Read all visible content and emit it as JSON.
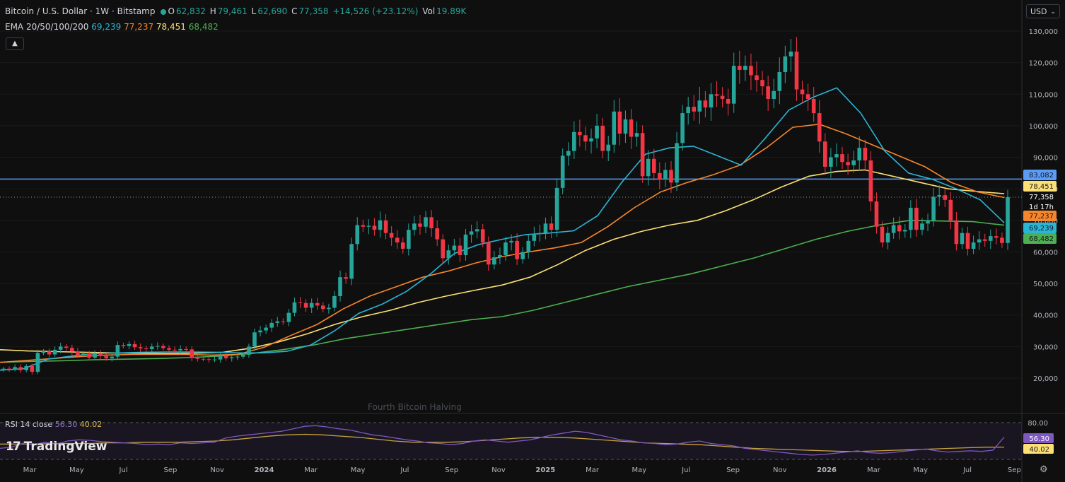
{
  "header": {
    "symbol": "Bitcoin / U.S. Dollar · 1W · Bitstamp",
    "open_label": "O",
    "open": "62,832",
    "high_label": "H",
    "high": "79,461",
    "low_label": "L",
    "low": "62,690",
    "close_label": "C",
    "close": "77,358",
    "change": "+14,526 (+23.12%)",
    "vol_label": "Vol",
    "vol": "19.89K"
  },
  "ema": {
    "label": "EMA 20/50/100/200",
    "v20": "69,239",
    "v50": "77,237",
    "v100": "78,451",
    "v200": "68,482"
  },
  "rsi": {
    "label": "RSI 14 close",
    "value": "56.30",
    "ma": "40.02"
  },
  "currency": {
    "label": "USD"
  },
  "logo": {
    "mark": "17",
    "text": "TradingView"
  },
  "colors": {
    "up": "#26a69a",
    "down": "#f23645",
    "ema20": "#2ab5d5",
    "ema50": "#f7862a",
    "ema100": "#fde073",
    "ema200": "#4caf50",
    "hline": "#5b9cf6",
    "rsi": "#7e57c2",
    "rsi_ma": "#c6a23e"
  },
  "icons": {
    "collapse": "chevron-up-icon",
    "dropdown": "chevron-down-icon",
    "settings": "gear-icon"
  },
  "chart_data": {
    "type": "candlestick",
    "timeframe": "1W",
    "price_axis": [
      130000,
      120000,
      110000,
      100000,
      90000,
      80000,
      70000,
      60000,
      50000,
      40000,
      30000,
      20000
    ],
    "price_axis_labels": [
      "130,000",
      "120,000",
      "110,000",
      "100,000",
      "90,000",
      "80,000",
      "70,000",
      "60,000",
      "50,000",
      "40,000",
      "30,000",
      "20,000"
    ],
    "ylim": [
      10000,
      135000
    ],
    "time_axis": [
      "Mar",
      "May",
      "Jul",
      "Sep",
      "Nov",
      "2024",
      "Mar",
      "May",
      "Jul",
      "Sep",
      "Nov",
      "2025",
      "Mar",
      "May",
      "Jul",
      "Sep",
      "Nov",
      "2026",
      "Mar",
      "May",
      "Jul",
      "Sep"
    ],
    "horizontal_line": 83082,
    "annotation": "Fourth Bitcoin Halving",
    "price_labels": [
      {
        "text": "83,082",
        "value": 83082,
        "color": "#5b9cf6"
      },
      {
        "text": "78,451",
        "value": 78451,
        "color": "#fde073"
      },
      {
        "text": "77,358",
        "value": 77358,
        "color": "#ffffff",
        "sub": "1d 17h"
      },
      {
        "text": "77,237",
        "value": 77237,
        "color": "#f7862a"
      },
      {
        "text": "69,239",
        "value": 69239,
        "color": "#2ab5d5"
      },
      {
        "text": "68,482",
        "value": 68482,
        "color": "#4caf50"
      }
    ],
    "closes": [
      23000,
      22800,
      23500,
      22500,
      23800,
      22000,
      28000,
      28500,
      27500,
      29000,
      30000,
      29600,
      28500,
      27300,
      27800,
      26500,
      27800,
      27000,
      26300,
      26800,
      30500,
      30200,
      30800,
      29800,
      29400,
      29200,
      30000,
      30200,
      29500,
      29000,
      28800,
      29200,
      29100,
      26400,
      26100,
      26000,
      25800,
      25900,
      27100,
      26300,
      26600,
      26800,
      27400,
      30000,
      34500,
      35100,
      36000,
      37500,
      38000,
      37800,
      40700,
      44000,
      43800,
      42300,
      43800,
      43000,
      41900,
      42300,
      46000,
      52000,
      51500,
      62500,
      68500,
      68000,
      68300,
      67000,
      70000,
      66000,
      64500,
      63000,
      61000,
      67000,
      69000,
      68000,
      71000,
      67500,
      64000,
      58000,
      60500,
      62000,
      59000,
      65500,
      66500,
      67200,
      63000,
      56000,
      58300,
      59000,
      63000,
      63500,
      57700,
      60000,
      63500,
      65700,
      66000,
      69000,
      67000,
      80300,
      90500,
      92000,
      98000,
      97000,
      95000,
      96000,
      100000,
      92000,
      94000,
      104500,
      97500,
      102000,
      96500,
      97700,
      84000,
      89500,
      85000,
      83000,
      86000,
      82000,
      94500,
      104000,
      106000,
      104500,
      108000,
      105800,
      110000,
      109500,
      108500,
      107000,
      119000,
      117700,
      119000,
      116000,
      114500,
      112500,
      108500,
      111000,
      117000,
      122000,
      123500,
      111500,
      110000,
      108500,
      104000,
      95000,
      87000,
      90000,
      91000,
      88500,
      87500,
      89000,
      93000,
      89000,
      76000,
      68000,
      63000,
      66000,
      68500,
      66500,
      67000,
      74000,
      67000,
      69000,
      70000,
      77500,
      78000,
      76500,
      70000,
      62500,
      66000,
      61000,
      63000,
      64000,
      63500,
      65000,
      64500,
      62832,
      77358
    ],
    "ema20": [
      22500,
      23000,
      26000,
      27000,
      27800,
      28000,
      28200,
      28300,
      28300,
      28200,
      28000,
      28000,
      28500,
      30500,
      35000,
      40500,
      43500,
      47500,
      53000,
      59500,
      62300,
      64000,
      65500,
      66000,
      66700,
      71500,
      82000,
      91000,
      93000,
      93500,
      90500,
      87500,
      96000,
      105000,
      109000,
      112000,
      104000,
      92000,
      85000,
      83000,
      80000,
      76500,
      69239
    ],
    "ema50": [
      25000,
      25600,
      26200,
      26800,
      27300,
      27500,
      27500,
      27500,
      27300,
      27500,
      29800,
      33500,
      37000,
      42000,
      46000,
      49000,
      52000,
      54000,
      56500,
      58500,
      60000,
      61300,
      63000,
      68000,
      74000,
      79000,
      82000,
      84500,
      87500,
      93000,
      99500,
      100500,
      97500,
      94000,
      90500,
      87000,
      82000,
      79000,
      77237
    ],
    "ema100": [
      29000,
      28600,
      28400,
      28200,
      28000,
      27900,
      27800,
      27900,
      28200,
      29500,
      31500,
      34000,
      37000,
      39500,
      41500,
      44000,
      46000,
      47800,
      49500,
      52000,
      56000,
      60500,
      64000,
      66500,
      68500,
      70000,
      73000,
      76500,
      80500,
      84000,
      85500,
      86000,
      84000,
      82000,
      80000,
      79200,
      78451
    ],
    "ema200": [
      25000,
      25300,
      25500,
      25800,
      26000,
      26200,
      26500,
      27000,
      27800,
      29000,
      30500,
      32500,
      34000,
      35500,
      37000,
      38500,
      39500,
      41500,
      44000,
      46500,
      49000,
      51000,
      53000,
      55500,
      58000,
      61000,
      64000,
      66500,
      68500,
      70000,
      69800,
      69600,
      68482
    ],
    "rsi": [
      38,
      40,
      46,
      44,
      48,
      45,
      50,
      52,
      51,
      49,
      48,
      47,
      46,
      44,
      45,
      44,
      47,
      46,
      47,
      48,
      55,
      58,
      60,
      62,
      64,
      66,
      70,
      74,
      75,
      73,
      70,
      68,
      64,
      60,
      58,
      55,
      52,
      50,
      47,
      46,
      44,
      46,
      50,
      52,
      50,
      48,
      50,
      52,
      56,
      60,
      63,
      66,
      64,
      60,
      56,
      52,
      50,
      47,
      46,
      44,
      45,
      48,
      50,
      46,
      44,
      42,
      38,
      36,
      34,
      32,
      30,
      28,
      27,
      28,
      30,
      32,
      34,
      31,
      30,
      31,
      33,
      35,
      37,
      34,
      32,
      33,
      34,
      33,
      35,
      56.3
    ],
    "rsi_ma": [
      45,
      45,
      45,
      46,
      46,
      46,
      47,
      47,
      48,
      48,
      48,
      49,
      50,
      52,
      55,
      58,
      60,
      61,
      60,
      58,
      56,
      53,
      50,
      48,
      48,
      48,
      49,
      51,
      53,
      55,
      56,
      56,
      55,
      53,
      51,
      49,
      47,
      46,
      45,
      44,
      42,
      40,
      38,
      37,
      36,
      35,
      34,
      33,
      33,
      34,
      35,
      36,
      37,
      38,
      39,
      40,
      40.02
    ],
    "rsi_levels": [
      80,
      20
    ],
    "rsi_labels": [
      "80.00"
    ]
  }
}
